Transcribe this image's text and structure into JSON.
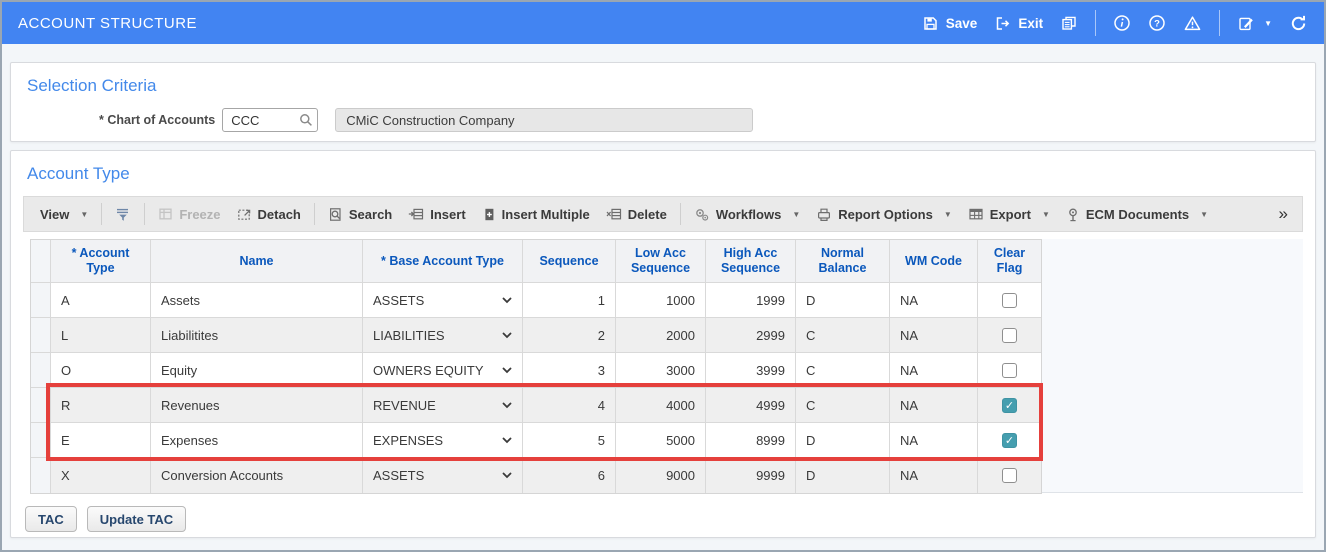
{
  "colors": {
    "appbar": "#4284F2",
    "section_title": "#4389EA",
    "table_header_text": "#0B58BC",
    "highlight_box": "#E5403C",
    "checked_checkbox": "#459EAF"
  },
  "icons": {
    "caret": "▼",
    "overflow": "»",
    "check": "✓",
    "help": "?"
  },
  "header": {
    "title": "ACCOUNT STRUCTURE",
    "save_label": "Save",
    "exit_label": "Exit"
  },
  "selection": {
    "title": "Selection Criteria",
    "coa_label": "* Chart of Accounts",
    "coa_value": "CCC",
    "coa_description": "CMiC Construction Company"
  },
  "account_type": {
    "title": "Account Type",
    "toolbar": {
      "view": "View",
      "freeze": "Freeze",
      "detach": "Detach",
      "search": "Search",
      "insert": "Insert",
      "insert_multiple": "Insert Multiple",
      "delete": "Delete",
      "workflows": "Workflows",
      "report_options": "Report Options",
      "export": "Export",
      "ecm_documents": "ECM Documents"
    },
    "table": {
      "columns": [
        "* Account Type",
        "Name",
        "* Base Account Type",
        "Sequence",
        "Low Acc Sequence",
        "High Acc Sequence",
        "Normal Balance",
        "WM Code",
        "Clear Flag"
      ],
      "rows": [
        {
          "type": "A",
          "name": "Assets",
          "base": "ASSETS",
          "seq": "1",
          "low": "1000",
          "high": "1999",
          "bal": "D",
          "wm": "NA",
          "flag": false
        },
        {
          "type": "L",
          "name": "Liabilitites",
          "base": "LIABILITIES",
          "seq": "2",
          "low": "2000",
          "high": "2999",
          "bal": "C",
          "wm": "NA",
          "flag": false
        },
        {
          "type": "O",
          "name": "Equity",
          "base": "OWNERS EQUITY",
          "seq": "3",
          "low": "3000",
          "high": "3999",
          "bal": "C",
          "wm": "NA",
          "flag": false
        },
        {
          "type": "R",
          "name": "Revenues",
          "base": "REVENUE",
          "seq": "4",
          "low": "4000",
          "high": "4999",
          "bal": "C",
          "wm": "NA",
          "flag": true
        },
        {
          "type": "E",
          "name": "Expenses",
          "base": "EXPENSES",
          "seq": "5",
          "low": "5000",
          "high": "8999",
          "bal": "D",
          "wm": "NA",
          "flag": true
        },
        {
          "type": "X",
          "name": "Conversion Accounts",
          "base": "ASSETS",
          "seq": "6",
          "low": "9000",
          "high": "9999",
          "bal": "D",
          "wm": "NA",
          "flag": false
        }
      ],
      "highlighted_rows": [
        "R",
        "E"
      ]
    }
  },
  "footer": {
    "tac_label": "TAC",
    "update_tac_label": "Update TAC"
  }
}
